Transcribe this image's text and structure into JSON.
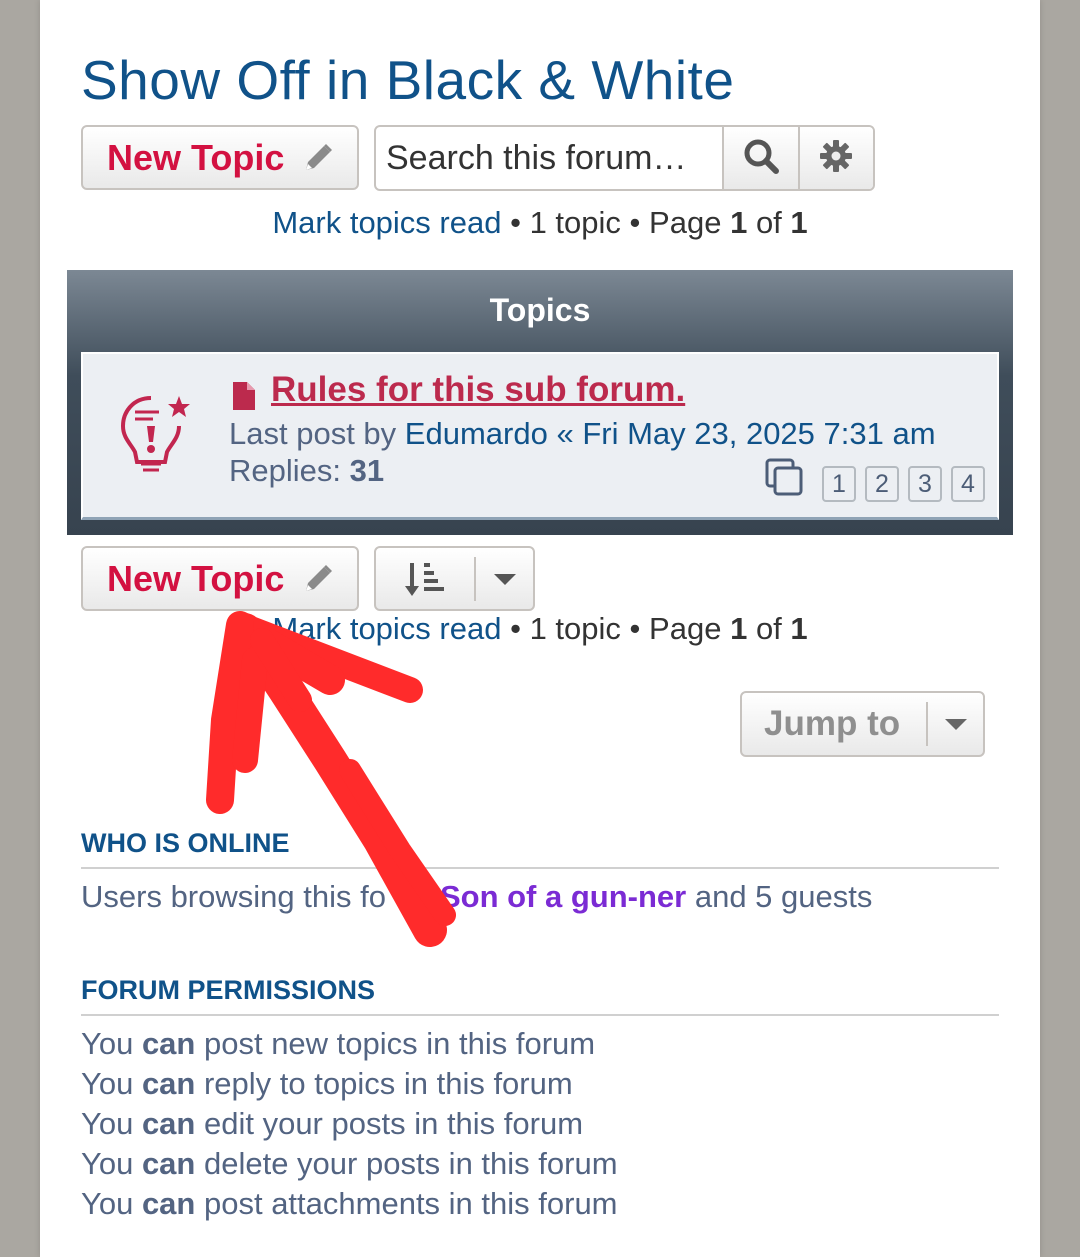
{
  "forum": {
    "title": "Show Off in Black & White"
  },
  "toolbar_top": {
    "new_topic_label": "New Topic",
    "search_placeholder": "Search this forum…"
  },
  "pagination": {
    "mark_read": "Mark topics read",
    "sep": "•",
    "topic_count": "1 topic",
    "page_word": "Page",
    "current_page": "1",
    "of_word": "of",
    "total_pages": "1"
  },
  "topics": {
    "header": "Topics",
    "items": [
      {
        "title": "Rules for this sub forum.",
        "last_post_prefix": "Last post by",
        "last_post_author": "Edumardo",
        "last_post_sep": "«",
        "last_post_date": "Fri May 23, 2025 7:31 am",
        "replies_label": "Replies:",
        "replies_count": "31",
        "pages": [
          "1",
          "2",
          "3",
          "4"
        ]
      }
    ]
  },
  "toolbar_bottom": {
    "new_topic_label": "New Topic",
    "jump_to_label": "Jump to"
  },
  "who_is_online": {
    "heading": "WHO IS ONLINE",
    "prefix": "Users browsing this fo",
    "user": "Son of a gun-ner",
    "suffix": "and 5 guests"
  },
  "permissions": {
    "heading": "FORUM PERMISSIONS",
    "lines": [
      {
        "pre": "You",
        "can": "can",
        "post": "post new topics in this forum"
      },
      {
        "pre": "You",
        "can": "can",
        "post": "reply to topics in this forum"
      },
      {
        "pre": "You",
        "can": "can",
        "post": "edit your posts in this forum"
      },
      {
        "pre": "You",
        "can": "can",
        "post": "delete your posts in this forum"
      },
      {
        "pre": "You",
        "can": "can",
        "post": "post attachments in this forum"
      }
    ]
  },
  "colors": {
    "title_blue": "#105289",
    "new_topic_red": "#d31141",
    "topic_title_red": "#bc2a4d",
    "annotation_arrow": "#ff2b2b",
    "username_purple": "#7b2bd4"
  }
}
